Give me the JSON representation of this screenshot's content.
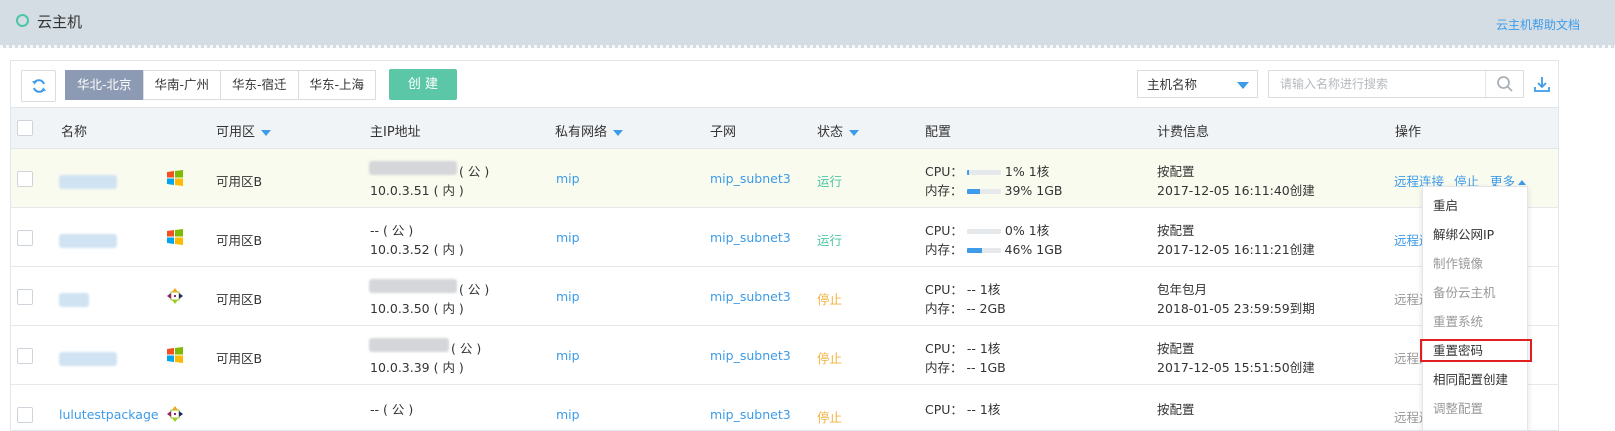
{
  "header": {
    "title": "云主机",
    "help_link": "云主机帮助文档"
  },
  "toolbar": {
    "regions": [
      "华北-北京",
      "华南-广州",
      "华东-宿迁",
      "华东-上海"
    ],
    "active_region": "华北-北京",
    "create_label": "创 建",
    "filter_value": "主机名称",
    "search_placeholder": "请输入名称进行搜索"
  },
  "columns": {
    "name": "名称",
    "zone": "可用区",
    "ip": "主IP地址",
    "vpc": "私有网络",
    "subnet": "子网",
    "status": "状态",
    "config": "配置",
    "billing": "计费信息",
    "actions": "操作"
  },
  "rows": [
    {
      "name": "",
      "os": "windows-icon",
      "zone": "可用区B",
      "public_ip": "( 公 )",
      "private_ip": "10.0.3.51 ( 内 )",
      "vpc": "mip",
      "subnet": "mip_subnet3",
      "status": "运行",
      "status_type": "run",
      "cpu_label": "CPU：",
      "cpu": "1%",
      "cores": "1核",
      "cpu_pct": 0.01,
      "mem_label": "内存：",
      "mem": "39%",
      "mem_size": "1GB",
      "mem_pct": 0.39,
      "billing": "按配置",
      "billing_time": "2017-12-05 16:11:40创建"
    },
    {
      "name": "",
      "os": "windows-icon",
      "zone": "可用区B",
      "public_ip": "-- ( 公 )",
      "private_ip": "10.0.3.52 ( 内 )",
      "vpc": "mip",
      "subnet": "mip_subnet3",
      "status": "运行",
      "status_type": "run",
      "cpu_label": "CPU：",
      "cpu": "0%",
      "cores": "1核",
      "cpu_pct": 0.0,
      "mem_label": "内存：",
      "mem": "46%",
      "mem_size": "1GB",
      "mem_pct": 0.46,
      "billing": "按配置",
      "billing_time": "2017-12-05 16:11:21创建"
    },
    {
      "name": "",
      "os": "centos-icon",
      "zone": "可用区B",
      "public_ip": "( 公 )",
      "private_ip": "10.0.3.50 ( 内 )",
      "vpc": "mip",
      "subnet": "mip_subnet3",
      "status": "停止",
      "status_type": "stop",
      "cpu_label": "CPU：",
      "cpu": "--",
      "cores": "1核",
      "mem_label": "内存：",
      "mem": "--",
      "mem_size": "2GB",
      "billing": "包年包月",
      "billing_time": "2018-01-05 23:59:59到期"
    },
    {
      "name": "",
      "os": "windows-icon",
      "zone": "可用区B",
      "public_ip": "( 公 )",
      "private_ip": "10.0.3.39 ( 内 )",
      "vpc": "mip",
      "subnet": "mip_subnet3",
      "status": "停止",
      "status_type": "stop",
      "cpu_label": "CPU：",
      "cpu": "--",
      "cores": "1核",
      "mem_label": "内存：",
      "mem": "--",
      "mem_size": "1GB",
      "billing": "按配置",
      "billing_time": "2017-12-05 15:51:50创建"
    },
    {
      "name": "lulutestpackage",
      "os": "centos-icon",
      "zone": "",
      "public_ip": "-- ( 公 )",
      "private_ip": "",
      "vpc": "mip",
      "subnet": "mip_subnet3",
      "status": "停止",
      "status_type": "stop",
      "cpu_label": "CPU：",
      "cpu": "--",
      "cores": "1核",
      "mem_label": "",
      "mem": "",
      "mem_size": "",
      "billing": "按配置",
      "billing_time": ""
    }
  ],
  "row_actions": {
    "connect": "远程连接",
    "stop": "停止",
    "more": "更多",
    "connect_short": "远程连"
  },
  "more_menu": [
    {
      "label": "重启",
      "enabled": true
    },
    {
      "label": "解绑公网IP",
      "enabled": true
    },
    {
      "label": "制作镜像",
      "enabled": false
    },
    {
      "label": "备份云主机",
      "enabled": false
    },
    {
      "label": "重置系统",
      "enabled": false
    },
    {
      "label": "重置密码",
      "enabled": true,
      "highlighted": true
    },
    {
      "label": "相同配置创建",
      "enabled": true
    },
    {
      "label": "调整配置",
      "enabled": false
    }
  ],
  "colors": {
    "accent": "#3d9be9",
    "run": "#4cc6a6",
    "stop": "#f2b13b",
    "create": "#5cc7a6",
    "active_region": "#8d9ab4",
    "highlight_box": "#e02020"
  }
}
